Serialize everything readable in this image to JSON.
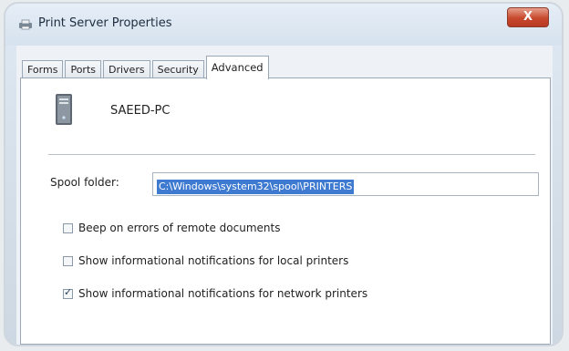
{
  "window": {
    "title": "Print Server Properties",
    "close_glyph": "X"
  },
  "tabs": [
    {
      "label": "Forms"
    },
    {
      "label": "Ports"
    },
    {
      "label": "Drivers"
    },
    {
      "label": "Security"
    },
    {
      "label": "Advanced",
      "active": true
    }
  ],
  "advanced": {
    "computer_name": "SAEED-PC",
    "spool_folder_label": "Spool folder:",
    "spool_folder_value": "C:\\Windows\\system32\\spool\\PRINTERS",
    "checkboxes": [
      {
        "label": "Beep on errors of remote documents",
        "checked": false
      },
      {
        "label": "Show informational notifications for local printers",
        "checked": false
      },
      {
        "label": "Show informational notifications for network printers",
        "checked": true
      }
    ]
  },
  "icons": {
    "app": "printer-icon",
    "computer": "computer-tower-icon",
    "close": "close-icon"
  },
  "colors": {
    "selection": "#3f7ad1",
    "close_button": "#c7482d"
  }
}
